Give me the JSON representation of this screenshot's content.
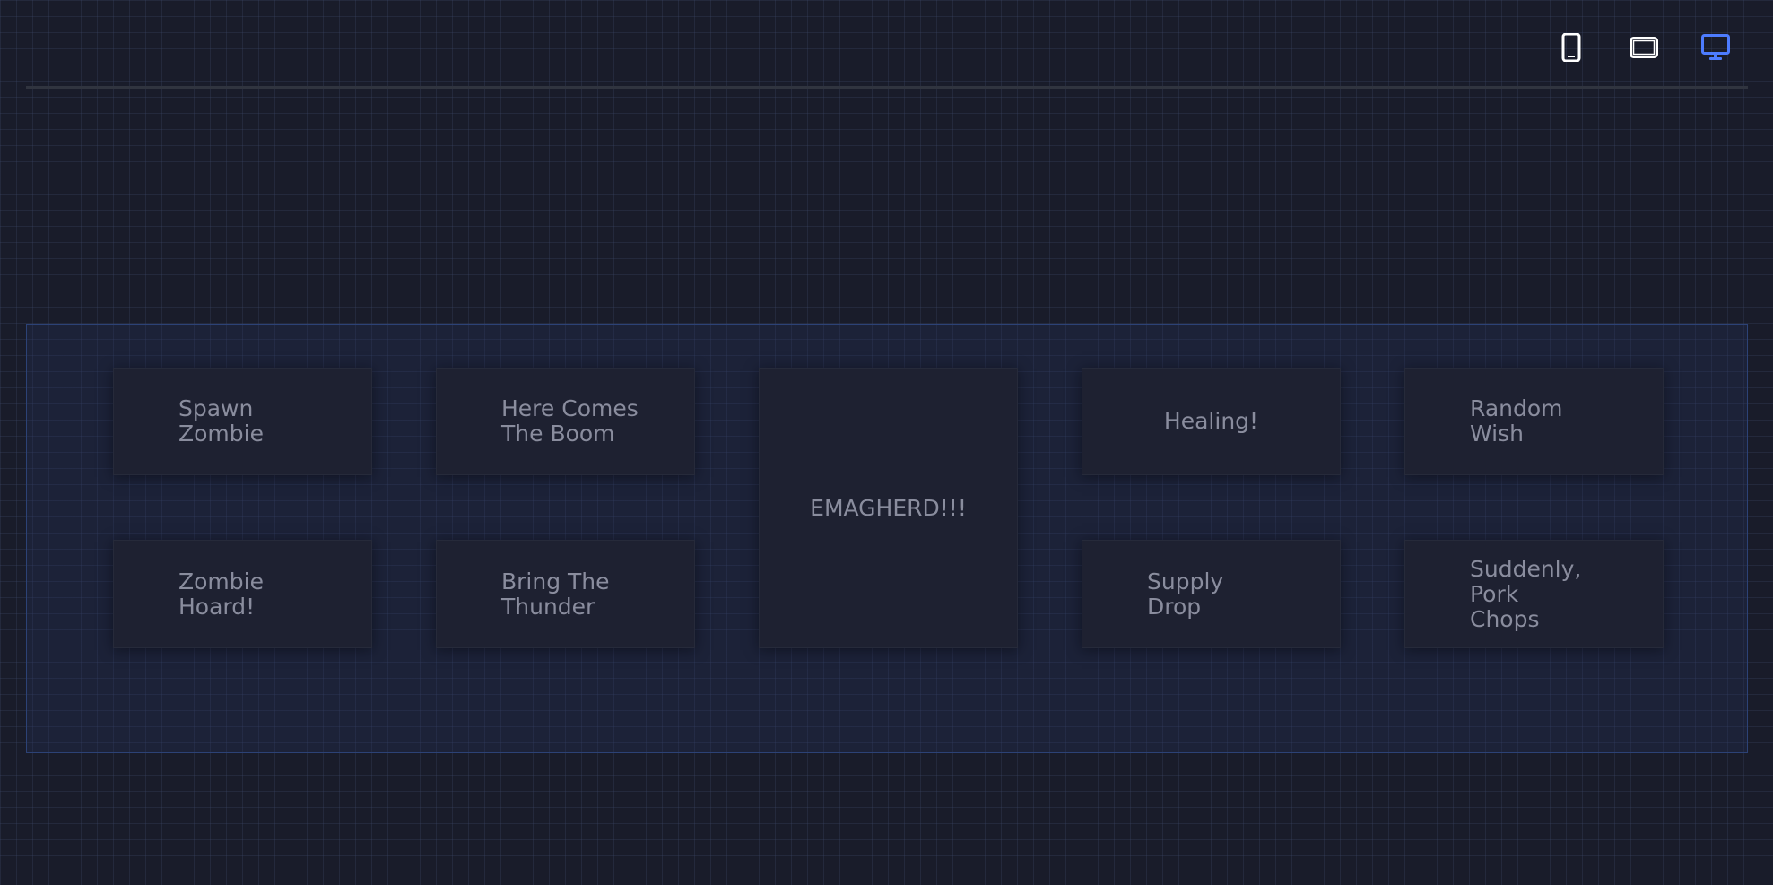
{
  "toolbar": {
    "icons": {
      "phone": "phone-icon",
      "tablet": "tablet-icon",
      "desktop": "desktop-icon"
    },
    "active_view": "desktop",
    "icon_color": "#ffffff",
    "active_color": "#4d7cff"
  },
  "grid": {
    "buttons": [
      {
        "label": "Spawn Zombie"
      },
      {
        "label": "Here Comes The Boom"
      },
      {
        "label": "EMAGHERD!!!"
      },
      {
        "label": "Healing!"
      },
      {
        "label": "Random Wish"
      },
      {
        "label": "Zombie Hoard!"
      },
      {
        "label": "Bring The Thunder"
      },
      {
        "label": "Supply Drop"
      },
      {
        "label": "Suddenly, Pork Chops"
      }
    ]
  },
  "colors": {
    "background": "#191c2a",
    "panel_border": "#2c4276",
    "tile_background": "#1e2131",
    "tile_text": "#8a8d9e"
  }
}
